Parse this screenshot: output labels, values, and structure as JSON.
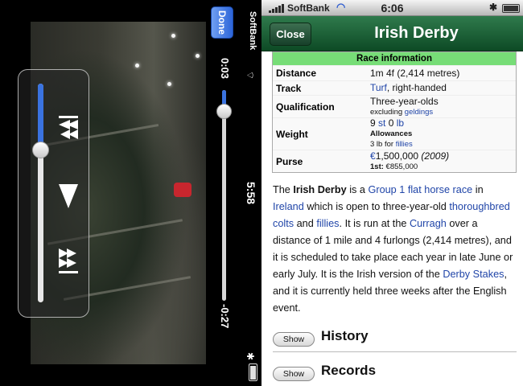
{
  "player": {
    "done_label": "Done",
    "elapsed": "0:03",
    "remaining": "-0:27",
    "progress_fraction": 0.1,
    "volume_fraction": 0.3,
    "carrier": "SoftBank",
    "time": "5:58"
  },
  "status_bar": {
    "carrier": "SoftBank",
    "time": "6:06"
  },
  "nav": {
    "close_label": "Close",
    "title": "Irish Derby"
  },
  "infobox": {
    "header": "Race information",
    "distance_label": "Distance",
    "distance_value": "1m 4f (2,414 metres)",
    "track_label": "Track",
    "track_link": "Turf",
    "track_rest": ", right-handed",
    "qualification_label": "Qualification",
    "qualification_value": "Three-year-olds",
    "qualification_excluding": "excluding ",
    "qualification_link": "geldings",
    "weight_label": "Weight",
    "weight_value_pre": "9 ",
    "weight_link_st": "st",
    "weight_space": " 0 ",
    "weight_link_lb": "lb",
    "weight_allowances": "Allowances",
    "weight_allow_pre": "3 lb for ",
    "weight_allow_link": "fillies",
    "purse_label": "Purse",
    "purse_link": "€",
    "purse_amount": "1,500,000",
    "purse_year": "(2009)",
    "purse_first_label": "1st:",
    "purse_first_value": " €855,000"
  },
  "article": {
    "t1": "The ",
    "t2": "Irish Derby",
    "t3": " is a ",
    "l1": "Group 1 flat horse race",
    "t4": " in ",
    "l2": "Ireland",
    "t5": " which is open to three-year-old ",
    "l3": "thoroughbred colts",
    "t6": " and ",
    "l4": "fillies",
    "t7": ". It is run at the ",
    "l5": "Curragh",
    "t8": " over a distance of 1 mile and 4 furlongs (2,414 metres), and it is scheduled to take place each year in late June or early July. It is the Irish version of the ",
    "l6": "Derby Stakes",
    "t9": ", and it is currently held three weeks after the English event."
  },
  "sections": [
    {
      "button": "Show",
      "title": "History"
    },
    {
      "button": "Show",
      "title": "Records"
    }
  ]
}
